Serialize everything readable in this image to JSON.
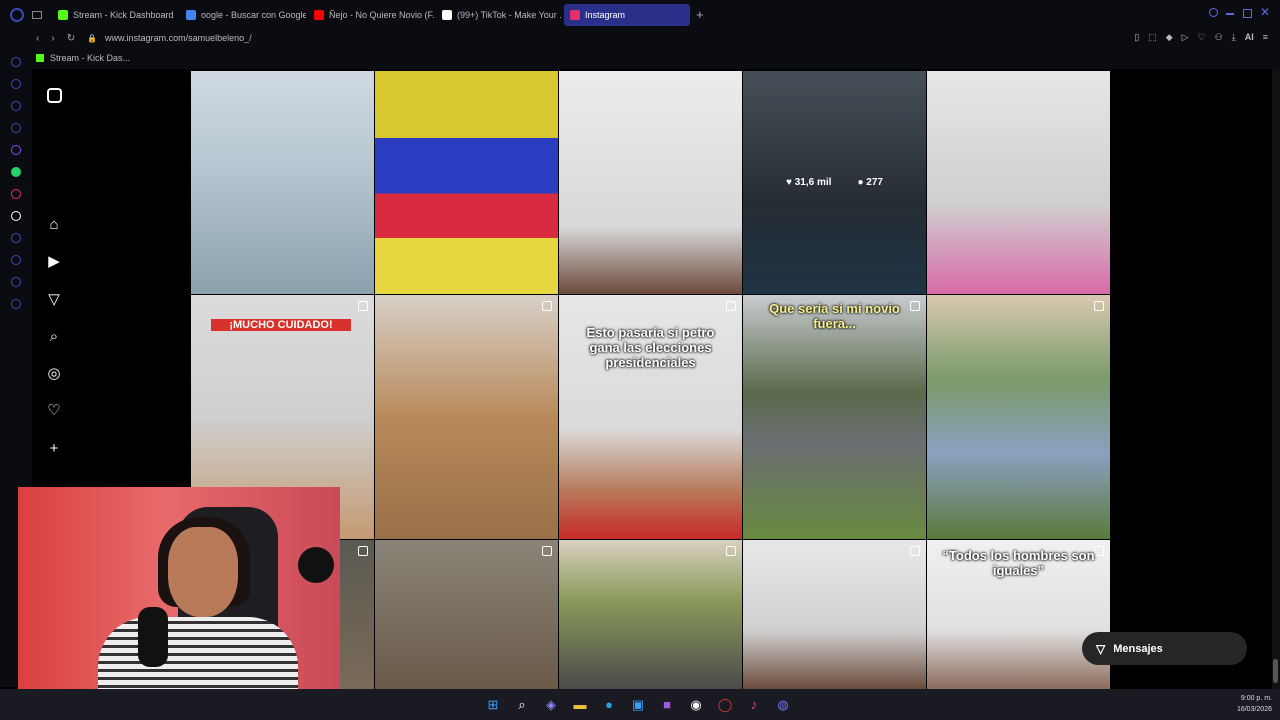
{
  "browser": {
    "tabs": [
      {
        "title": "Stream - Kick Dashboard",
        "color": "#53fc18"
      },
      {
        "title": "oogle - Buscar con Google",
        "color": "#4285f4"
      },
      {
        "title": "Ñejo - No Quiere Novio (F...",
        "color": "#ff0000"
      },
      {
        "title": "(99+) TikTok - Make Your ...",
        "color": "#ffffff"
      },
      {
        "title": "Instagram",
        "color": "#e1306c"
      }
    ],
    "new_tab": "+",
    "url": "www.instagram.com/samuelbeleno_/",
    "bookmark": "Stream - Kick Das..."
  },
  "posts": [
    {
      "caption": "",
      "reel": false,
      "bg": "linear-gradient(180deg,#cfd8e0 0%,#b9c8d2 40%,#8aa2ae 100%)"
    },
    {
      "caption": "",
      "reel": false,
      "bg": "linear-gradient(180deg,#d8c830 0%,#d8c830 30%,#2a3cc0 30%,#2a3cc0 55%,#d82a40 55%,#d82a40 75%,#e6d640 75%)"
    },
    {
      "caption": "",
      "reel": false,
      "bg": "linear-gradient(180deg,#ececec 0%,#d8d8d8 70%,#6b4a3a 100%)"
    },
    {
      "caption": "",
      "reel": false,
      "bg": "linear-gradient(180deg,#6b7a86 0%,#3a4450 60%,#30506a 100%)"
    },
    {
      "caption": "",
      "reel": false,
      "bg": "linear-gradient(180deg,#e6e6e6 0%,#cfcfcf 60%,#d86aa8 100%)"
    },
    {
      "caption": "¡MUCHO CUIDADO!",
      "reel": true,
      "bg": "linear-gradient(180deg,#dcdcdc 0%,#cfcfcf 50%,#c49a72 100%)"
    },
    {
      "caption": "",
      "reel": true,
      "bg": "linear-gradient(180deg,#d8d0c8 0%,#b88a5a 50%,#9a7048 100%)"
    },
    {
      "caption": "Esto pasaría si petro gana las elecciones presidenciales",
      "reel": true,
      "bg": "linear-gradient(180deg,#e6e6e6 0%,#dadada 55%,#b87a5a 80%,#c82a2a 100%)"
    },
    {
      "caption": "Que sería si mi novio fuera...",
      "reel": true,
      "bg": "linear-gradient(180deg,#c8ccd0 0%,#5a6a4a 40%,#6a6e72 60%,#6a8a40 100%)"
    },
    {
      "caption": "",
      "reel": true,
      "bg": "linear-gradient(180deg,#d8c8b0 0%,#7a9a6a 35%,#8aa0c0 65%,#5a7a3a 100%)"
    },
    {
      "caption": "",
      "reel": true,
      "bg": "linear-gradient(180deg,#5a5a52 0%,#7a6a58 100%)"
    },
    {
      "caption": "",
      "reel": true,
      "bg": "linear-gradient(180deg,#8a8478 0%,#6a5a48 100%)"
    },
    {
      "caption": "",
      "reel": true,
      "bg": "linear-gradient(180deg,#d8d0c0 0%,#8a9a5a 40%,#4a4a4a 100%)"
    },
    {
      "caption": "",
      "reel": true,
      "bg": "linear-gradient(180deg,#e8e8e8 0%,#d0d0d0 60%,#6a4a3a 100%)"
    },
    {
      "caption": "“Todos los hombres son iguales”",
      "reel": true,
      "bg": "linear-gradient(180deg,#f0f0f0 0%,#e0e0e0 60%,#8a6a5a 100%)"
    }
  ],
  "hover_stats": {
    "likes": "31,6 mil",
    "comments": "277"
  },
  "messages_label": "Mensajes",
  "tray": {
    "time": "9:00 p. m.",
    "date": "16/03/2026"
  }
}
